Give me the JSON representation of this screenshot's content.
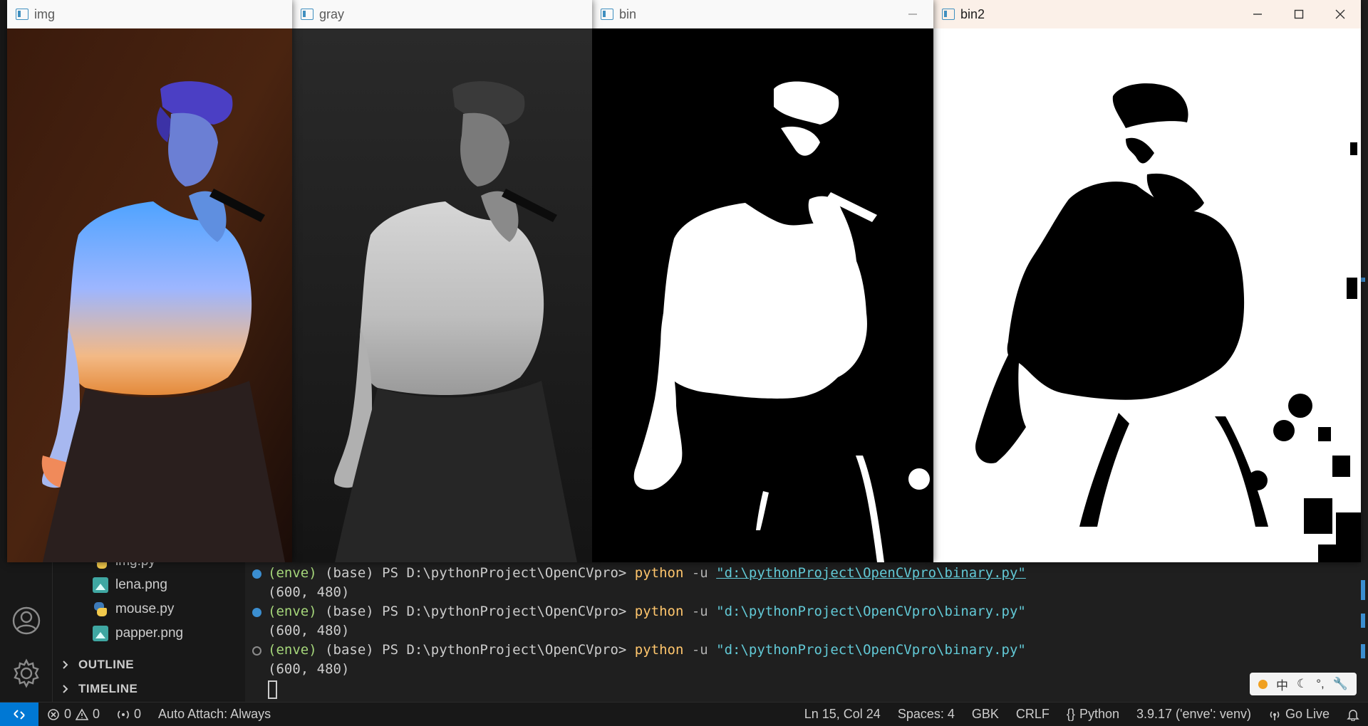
{
  "windows": {
    "img": {
      "title": "img"
    },
    "gray": {
      "title": "gray"
    },
    "bin": {
      "title": "bin"
    },
    "bin2": {
      "title": "bin2"
    }
  },
  "explorer": {
    "files": [
      {
        "name": "img.py",
        "type": "python"
      },
      {
        "name": "lena.png",
        "type": "image"
      },
      {
        "name": "mouse.py",
        "type": "python"
      },
      {
        "name": "papper.png",
        "type": "image"
      }
    ],
    "sections": [
      "OUTLINE",
      "TIMELINE"
    ]
  },
  "terminal": {
    "lines": [
      {
        "env": "(enve)",
        "prompt": " (base) PS D:\\pythonProject\\OpenCVpro> ",
        "cmd": "python",
        "flag": " -u ",
        "arg": "\"d:\\pythonProject\\OpenCVpro\\binary.py\"",
        "output": "(600, 480)",
        "status": "filled",
        "underlined": true
      },
      {
        "env": "(enve)",
        "prompt": " (base) PS D:\\pythonProject\\OpenCVpro> ",
        "cmd": "python",
        "flag": " -u ",
        "arg": "\"d:\\pythonProject\\OpenCVpro\\binary.py\"",
        "output": "(600, 480)",
        "status": "filled",
        "underlined": false
      },
      {
        "env": "(enve)",
        "prompt": " (base) PS D:\\pythonProject\\OpenCVpro> ",
        "cmd": "python",
        "flag": " -u ",
        "arg": "\"d:\\pythonProject\\OpenCVpro\\binary.py\"",
        "output": "(600, 480)",
        "status": "hollow",
        "underlined": false
      }
    ]
  },
  "ime": {
    "mode_char": "中"
  },
  "statusbar": {
    "errors": "0",
    "warnings": "0",
    "ports": "0",
    "auto_attach": "Auto Attach: Always",
    "cursor_pos": "Ln 15, Col 24",
    "spaces": "Spaces: 4",
    "encoding": "GBK",
    "eol": "CRLF",
    "language": "Python",
    "interpreter": "3.9.17 ('enve': venv)",
    "go_live": "Go Live"
  },
  "colors": {
    "accent": "#0078d4",
    "terminal_green": "#a5d67a",
    "terminal_cmd": "#ffc66d",
    "terminal_string": "#62c9d6"
  }
}
